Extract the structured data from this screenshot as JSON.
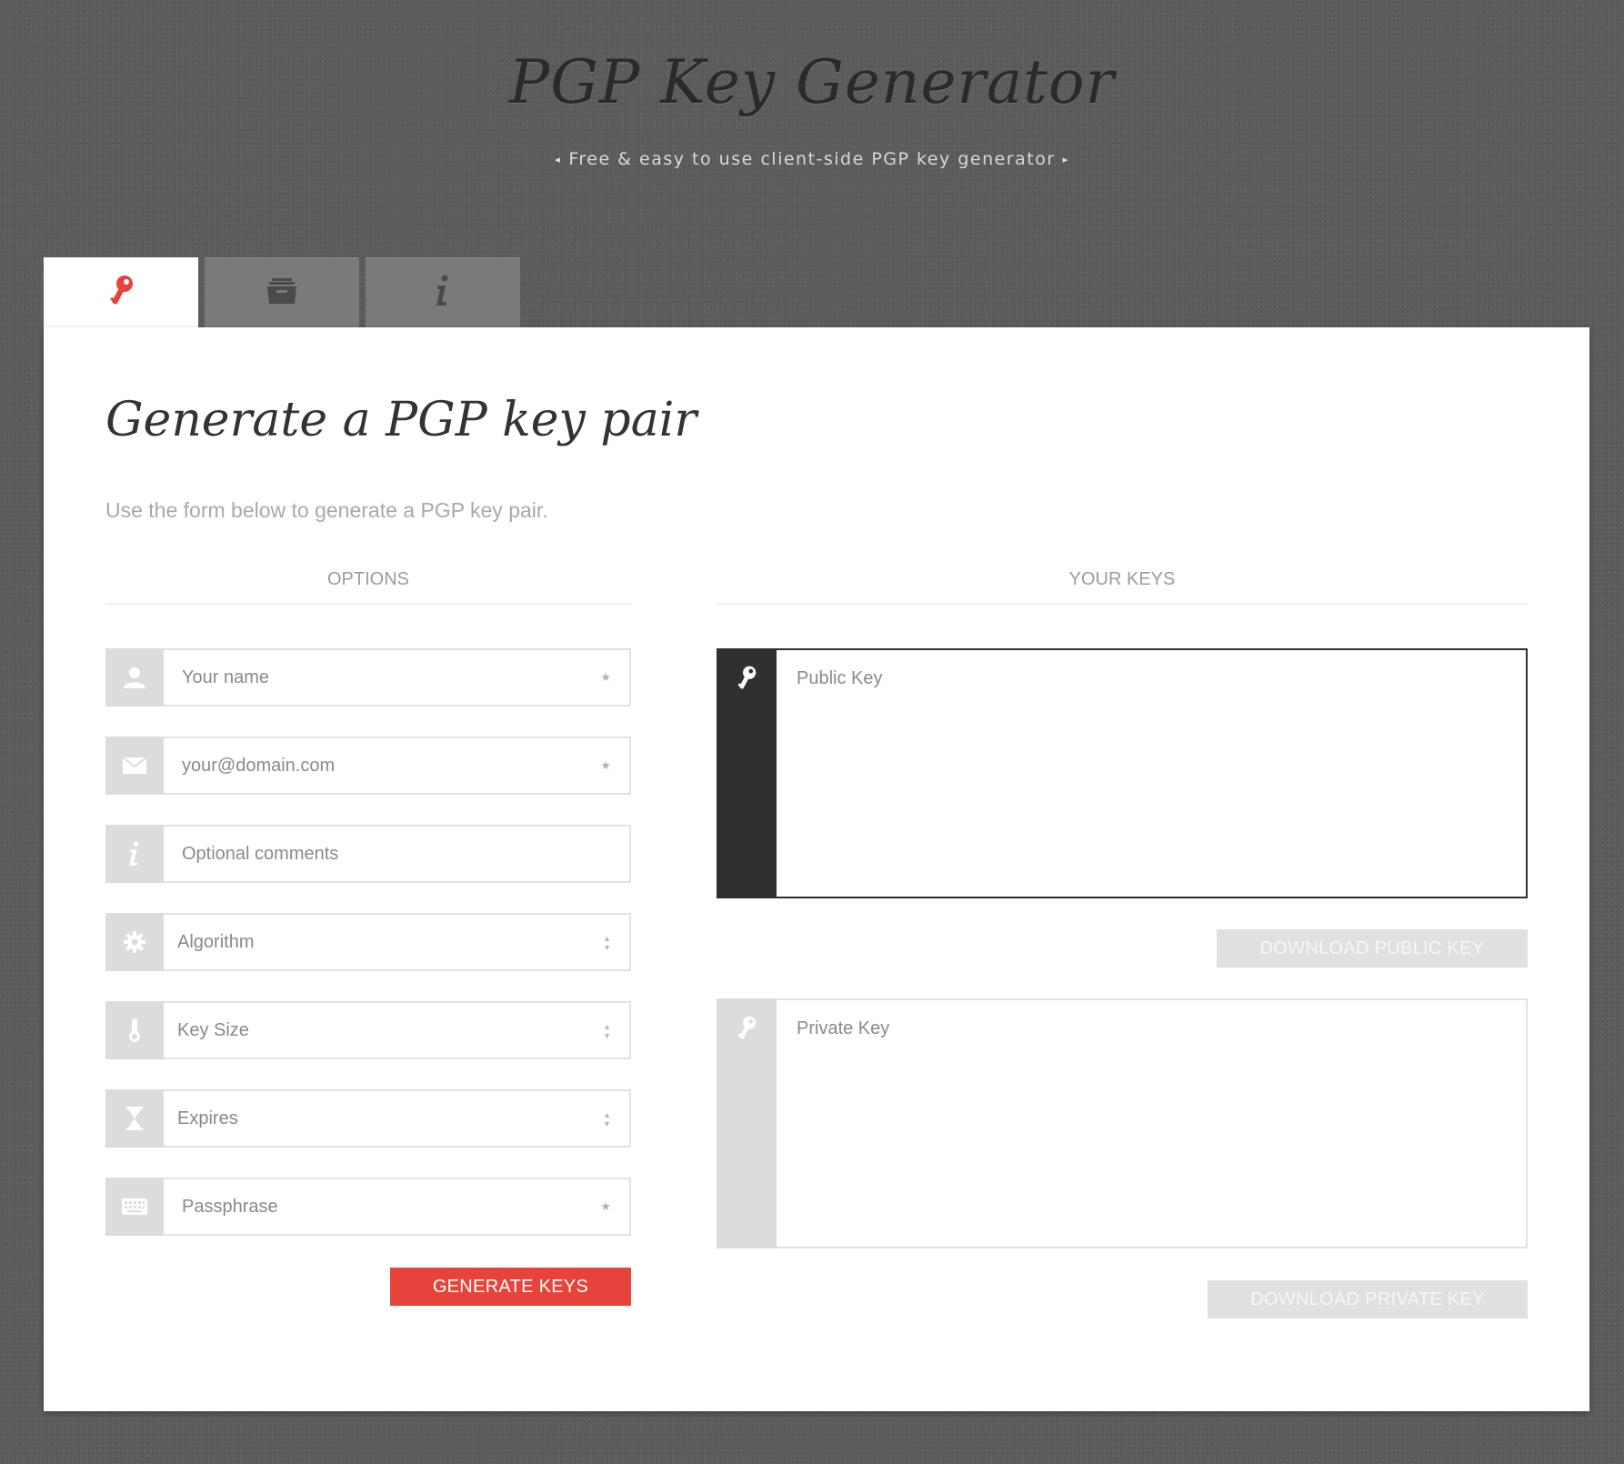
{
  "header": {
    "title": "PGP Key Generator",
    "subtitle": "Free & easy to use client-side PGP key generator",
    "arrow_left": "◂",
    "arrow_right": "▸"
  },
  "tabs": [
    {
      "icon": "key-icon",
      "active": true
    },
    {
      "icon": "archive-icon",
      "active": false
    },
    {
      "icon": "info-icon",
      "active": false
    }
  ],
  "main": {
    "title": "Generate a PGP key pair",
    "description": "Use the form below to generate a PGP key pair."
  },
  "options": {
    "heading": "OPTIONS",
    "name": {
      "placeholder": "Your name",
      "required_mark": "★",
      "icon": "user-icon"
    },
    "email": {
      "placeholder": "your@domain.com",
      "required_mark": "★",
      "icon": "envelope-icon"
    },
    "comments": {
      "placeholder": "Optional comments",
      "icon": "info-icon"
    },
    "algorithm": {
      "label": "Algorithm",
      "arrows": "▲\n▼",
      "icon": "gear-icon"
    },
    "key_size": {
      "label": "Key Size",
      "arrows": "▲\n▼",
      "icon": "thermometer-icon"
    },
    "expires": {
      "label": "Expires",
      "arrows": "▲\n▼",
      "icon": "hourglass-icon"
    },
    "passphrase": {
      "placeholder": "Passphrase",
      "required_mark": "★",
      "icon": "keyboard-icon"
    },
    "generate_label": "GENERATE KEYS"
  },
  "keys": {
    "heading": "YOUR KEYS",
    "public": {
      "placeholder": "Public Key",
      "icon": "key-icon"
    },
    "download_public_label": "DOWNLOAD PUBLIC KEY",
    "private": {
      "placeholder": "Private Key",
      "icon": "key-icon"
    },
    "download_private_label": "DOWNLOAD PRIVATE KEY"
  },
  "colors": {
    "accent": "#e8433a",
    "dark": "#303030",
    "addon": "#dcdcdc"
  }
}
